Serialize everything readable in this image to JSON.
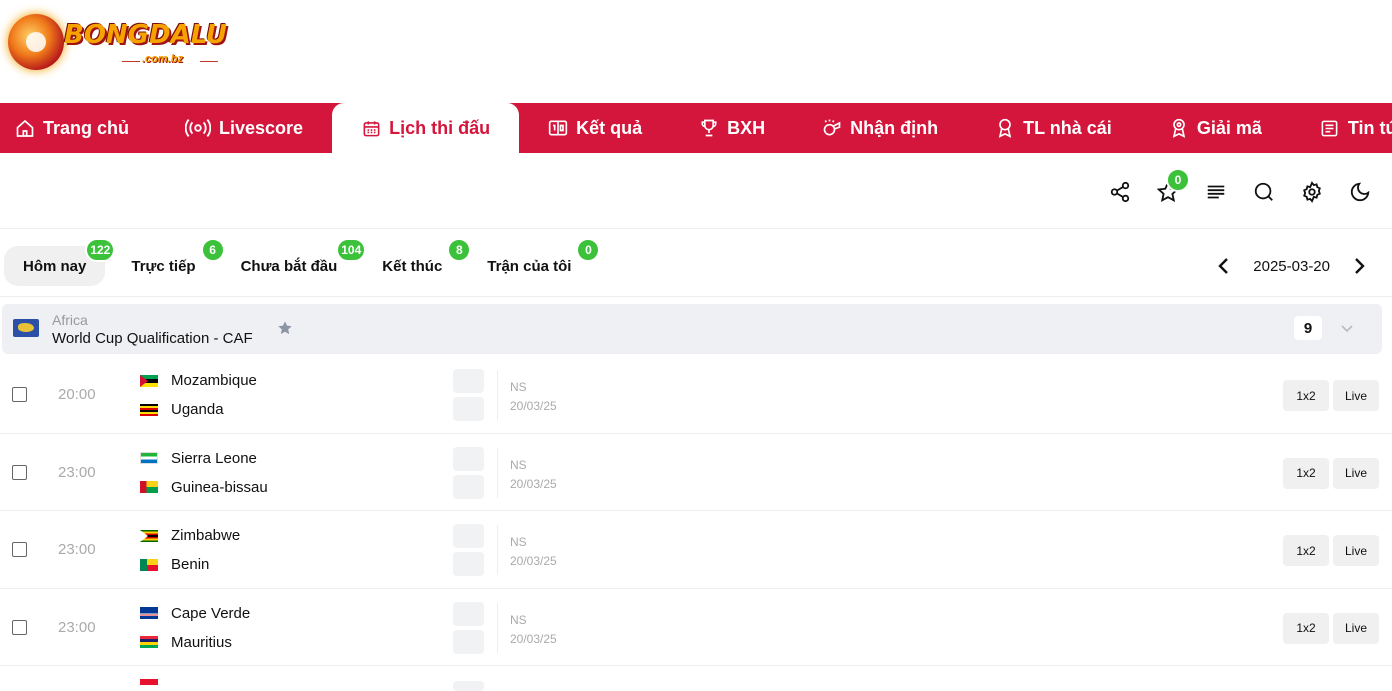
{
  "brand": {
    "name": "BONGDALU",
    "sub": ".com.bz"
  },
  "nav": [
    {
      "label": "Trang chủ",
      "icon": "home-icon"
    },
    {
      "label": "Livescore",
      "icon": "broadcast-icon"
    },
    {
      "label": "Lịch thi đấu",
      "icon": "calendar-icon",
      "active": true
    },
    {
      "label": "Kết quả",
      "icon": "scoreboard-icon"
    },
    {
      "label": "BXH",
      "icon": "trophy-icon"
    },
    {
      "label": "Nhận định",
      "icon": "whistle-icon"
    },
    {
      "label": "TL nhà cái",
      "icon": "award-icon"
    },
    {
      "label": "Giải mã",
      "icon": "medal-icon"
    },
    {
      "label": "Tin tức",
      "icon": "news-icon"
    }
  ],
  "toolbar": {
    "favorites_count": "0"
  },
  "tabs": [
    {
      "label": "Hôm nay",
      "count": "122",
      "active": true
    },
    {
      "label": "Trực tiếp",
      "count": "6"
    },
    {
      "label": "Chưa bắt đầu",
      "count": "104"
    },
    {
      "label": "Kết thúc",
      "count": "8"
    },
    {
      "label": "Trận của tôi",
      "count": "0"
    }
  ],
  "date": "2025-03-20",
  "league": {
    "region": "Africa",
    "name": "World Cup Qualification - CAF",
    "count": "9"
  },
  "matches": [
    {
      "time": "20:00",
      "home": "Mozambique",
      "away": "Uganda",
      "status": "NS",
      "date": "20/03/25"
    },
    {
      "time": "23:00",
      "home": "Sierra Leone",
      "away": "Guinea-bissau",
      "status": "NS",
      "date": "20/03/25"
    },
    {
      "time": "23:00",
      "home": "Zimbabwe",
      "away": "Benin",
      "status": "NS",
      "date": "20/03/25"
    },
    {
      "time": "23:00",
      "home": "Cape Verde",
      "away": "Mauritius",
      "status": "NS",
      "date": "20/03/25"
    }
  ],
  "buttons": {
    "odds": "1x2",
    "live": "Live"
  },
  "colors": {
    "brand_red": "#d4163c",
    "badge_green": "#3cc13b"
  }
}
